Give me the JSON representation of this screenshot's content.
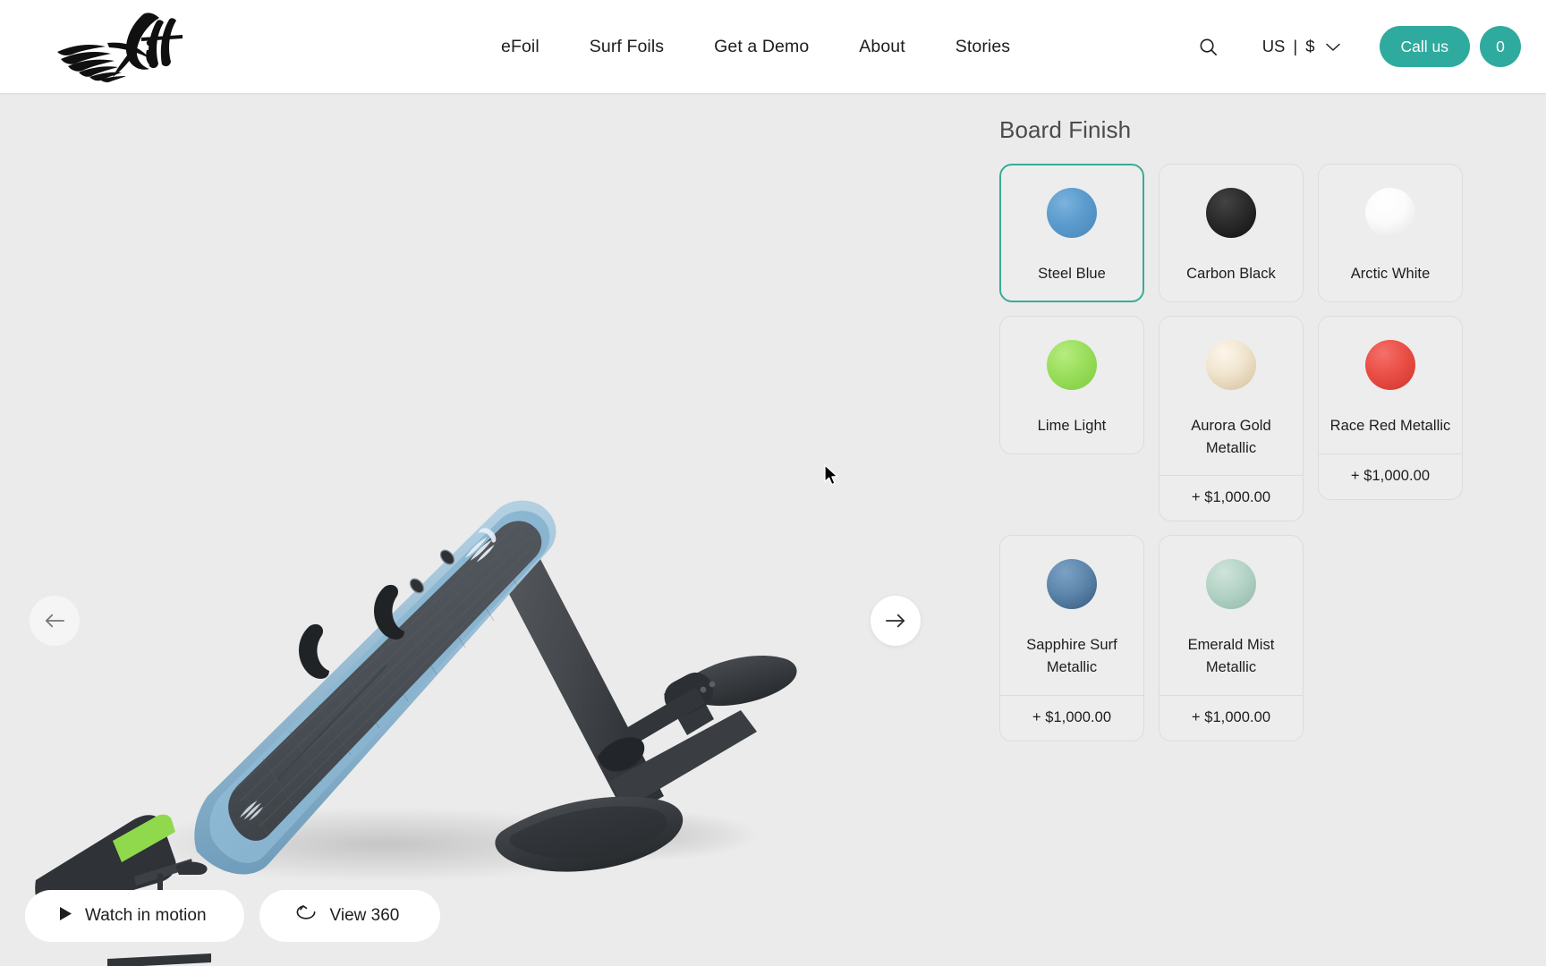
{
  "header": {
    "logo_alt": "Lift",
    "nav": [
      {
        "label": "eFoil"
      },
      {
        "label": "Surf Foils"
      },
      {
        "label": "Get a Demo"
      },
      {
        "label": "About"
      },
      {
        "label": "Stories"
      }
    ],
    "search_icon": "search-icon",
    "locale": {
      "region": "US",
      "separator": "|",
      "currency": "$",
      "chevron": "chevron-down-icon"
    },
    "call_label": "Call us",
    "cart_count": "0",
    "accent_color": "#2faa9e"
  },
  "gallery": {
    "prev_label": "←",
    "next_label": "→",
    "watch_label": "Watch in motion",
    "watch_icon": "play-icon",
    "view360_label": "View 360",
    "view360_icon": "rotate-360-icon",
    "product_alt": "Lift eFoil board with hydrofoil"
  },
  "options": {
    "title": "Board Finish",
    "selected_color": "#3aab96",
    "items": [
      {
        "name": "Steel Blue",
        "color": "#5b9bcd",
        "color_dark": "#4a86b8",
        "price": "",
        "selected": true
      },
      {
        "name": "Carbon Black",
        "color": "#2b2b2b",
        "color_dark": "#141414",
        "price": "",
        "selected": false
      },
      {
        "name": "Arctic White",
        "color": "#fbfbfb",
        "color_dark": "#e4e4e4",
        "price": "",
        "selected": false
      },
      {
        "name": "Lime Light",
        "color": "#9ade5c",
        "color_dark": "#7fcb3d",
        "price": "",
        "selected": false
      },
      {
        "name": "Aurora Gold Metallic",
        "color": "#f0e4ce",
        "color_dark": "#d9c6a5",
        "price": "+ $1,000.00",
        "selected": false
      },
      {
        "name": "Race Red Metallic",
        "color": "#ea4f46",
        "color_dark": "#d23b33",
        "price": "+ $1,000.00",
        "selected": false
      },
      {
        "name": "Sapphire Surf Metallic",
        "color": "#5e87ad",
        "color_dark": "#3a5c7e",
        "price": "+ $1,000.00",
        "selected": false
      },
      {
        "name": "Emerald Mist Metallic",
        "color": "#b4d3c6",
        "color_dark": "#92b9aa",
        "price": "+ $1,000.00",
        "selected": false
      }
    ]
  }
}
